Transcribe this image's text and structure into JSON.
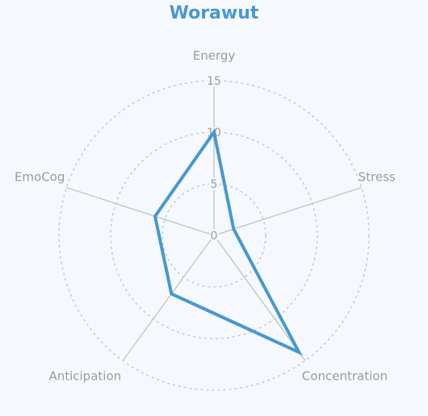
{
  "chart_data": {
    "type": "radar",
    "title": "Worawut",
    "axes": [
      "Energy",
      "Stress",
      "Concentration",
      "Anticipation",
      "EmoCog"
    ],
    "radial_ticks": [
      0,
      5,
      10,
      15
    ],
    "rlim": [
      0,
      15
    ],
    "series": [
      {
        "values": [
          10,
          2,
          14,
          7,
          6
        ]
      }
    ],
    "grid": true,
    "legend": "none",
    "colors": {
      "series": "#4a97cf",
      "title": "#4a97cf",
      "grid": "#c8c8c8",
      "label": "#9a9a9a",
      "background": "#f5f9fd"
    }
  }
}
